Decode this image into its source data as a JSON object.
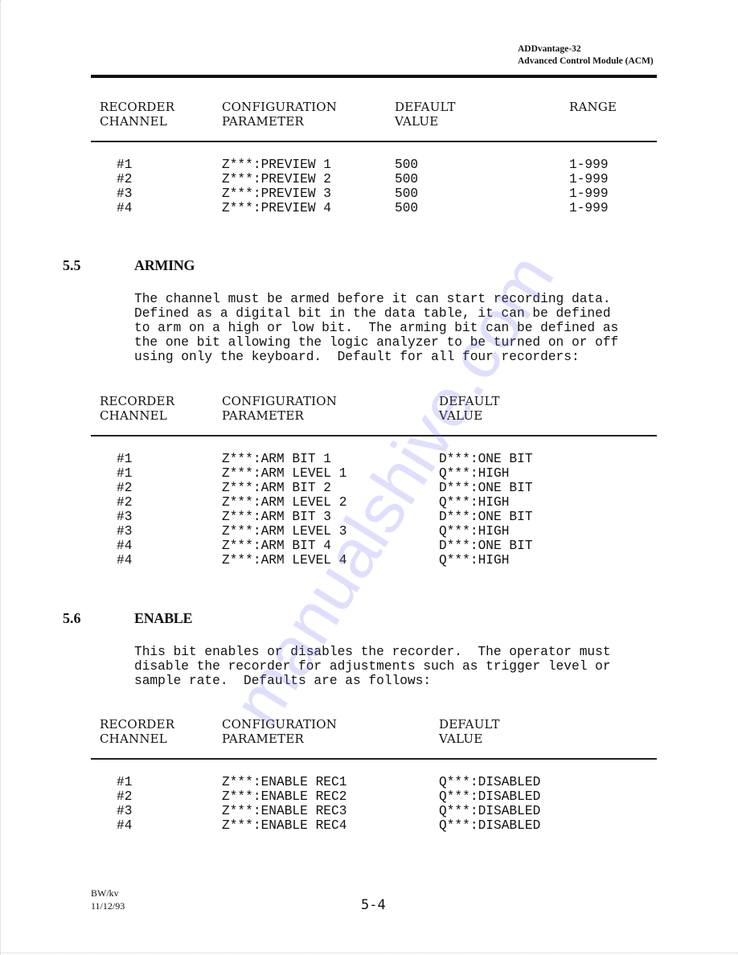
{
  "header": {
    "product": "ADDvantage-32",
    "module": "Advanced Control Module (ACM)"
  },
  "table_preview": {
    "columns": [
      [
        "RECORDER",
        "CHANNEL"
      ],
      [
        "CONFIGURATION",
        "PARAMETER"
      ],
      [
        "DEFAULT",
        "VALUE"
      ],
      [
        "RANGE",
        ""
      ]
    ],
    "rows": [
      {
        "channel": "#1",
        "parameter": "Z***:PREVIEW 1",
        "default": "500",
        "range": "1-999"
      },
      {
        "channel": "#2",
        "parameter": "Z***:PREVIEW 2",
        "default": "500",
        "range": "1-999"
      },
      {
        "channel": "#3",
        "parameter": "Z***:PREVIEW 3",
        "default": "500",
        "range": "1-999"
      },
      {
        "channel": "#4",
        "parameter": "Z***:PREVIEW 4",
        "default": "500",
        "range": "1-999"
      }
    ]
  },
  "section_arming": {
    "number": "5.5",
    "title": "ARMING",
    "paragraph_lines": [
      "The channel must be armed before it can start recording data.",
      "Defined as a digital bit in the data table, it can be defined",
      "to arm on a high or low bit.  The arming bit can be defined as",
      "the one bit allowing the logic analyzer to be turned on or off",
      "using only the keyboard.  Default for all four recorders:"
    ],
    "columns": [
      [
        "RECORDER",
        "CHANNEL"
      ],
      [
        "CONFIGURATION",
        "PARAMETER"
      ],
      [
        "DEFAULT",
        "VALUE"
      ]
    ],
    "rows": [
      {
        "channel": "#1",
        "parameter": "Z***:ARM BIT 1",
        "default": "D***:ONE BIT"
      },
      {
        "channel": "#1",
        "parameter": "Z***:ARM LEVEL 1",
        "default": "Q***:HIGH"
      },
      {
        "channel": "#2",
        "parameter": "Z***:ARM BIT 2",
        "default": "D***:ONE BIT"
      },
      {
        "channel": "#2",
        "parameter": "Z***:ARM LEVEL 2",
        "default": "Q***:HIGH"
      },
      {
        "channel": "#3",
        "parameter": "Z***:ARM BIT 3",
        "default": "D***:ONE BIT"
      },
      {
        "channel": "#3",
        "parameter": "Z***:ARM LEVEL 3",
        "default": "Q***:HIGH"
      },
      {
        "channel": "#4",
        "parameter": "Z***:ARM BIT 4",
        "default": "D***:ONE BIT"
      },
      {
        "channel": "#4",
        "parameter": "Z***:ARM LEVEL 4",
        "default": "Q***:HIGH"
      }
    ]
  },
  "section_enable": {
    "number": "5.6",
    "title": "ENABLE",
    "paragraph_lines": [
      "This bit enables or disables the recorder.  The operator must",
      "disable the recorder for adjustments such as trigger level or",
      "sample rate.  Defaults are as follows:"
    ],
    "columns": [
      [
        "RECORDER",
        "CHANNEL"
      ],
      [
        "CONFIGURATION",
        "PARAMETER"
      ],
      [
        "DEFAULT",
        "VALUE"
      ]
    ],
    "rows": [
      {
        "channel": "#1",
        "parameter": "Z***:ENABLE REC1",
        "default": "Q***:DISABLED"
      },
      {
        "channel": "#2",
        "parameter": "Z***:ENABLE REC2",
        "default": "Q***:DISABLED"
      },
      {
        "channel": "#3",
        "parameter": "Z***:ENABLE REC3",
        "default": "Q***:DISABLED"
      },
      {
        "channel": "#4",
        "parameter": "Z***:ENABLE REC4",
        "default": "Q***:DISABLED"
      }
    ]
  },
  "footer": {
    "author": "BW/kv",
    "date": "11/12/93",
    "page_number": "5-4"
  },
  "watermark": "manualshive.com"
}
